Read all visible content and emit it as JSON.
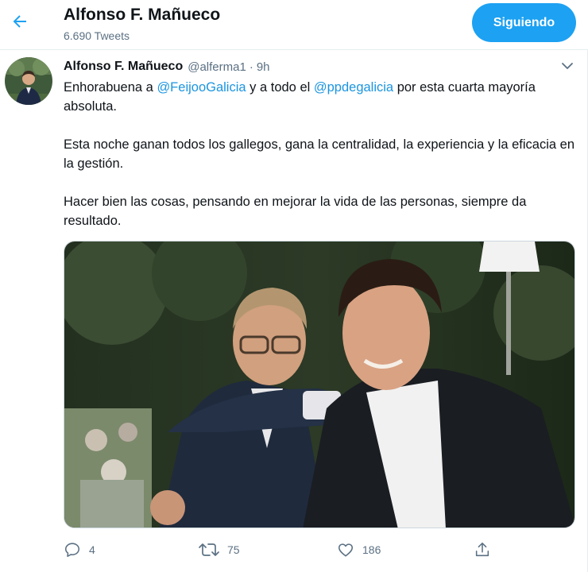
{
  "header": {
    "title": "Alfonso F. Mañueco",
    "tweet_count": "6.690 Tweets",
    "follow_label": "Siguiendo",
    "back_icon": "arrow-left-icon"
  },
  "tweet": {
    "author_name": "Alfonso F. Mañueco",
    "handle": "@alferma1",
    "separator": "·",
    "time": "9h",
    "text": {
      "p1_prefix": "Enhorabuena a ",
      "p1_mention1": "@FeijooGalicia",
      "p1_middle": " y a todo el ",
      "p1_mention2": "@ppdegalicia",
      "p1_suffix": " por esta cuarta mayoría absoluta.",
      "p2": "Esta noche ganan todos los gallegos, gana la centralidad, la experiencia y la eficacia en la gestión.",
      "p3": "Hacer bien las cosas, pensando en mejorar la vida de las personas, siempre da resultado."
    },
    "actions": {
      "replies": "4",
      "retweets": "75",
      "likes": "186"
    }
  },
  "colors": {
    "accent": "#1da1f2",
    "link": "#1b95e0",
    "muted": "#5b7083"
  }
}
